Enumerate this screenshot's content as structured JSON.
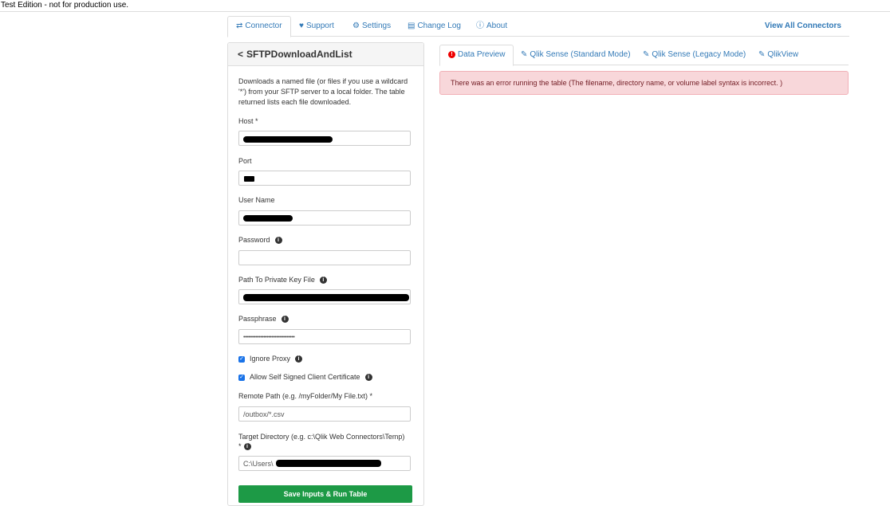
{
  "banner": "Test Edition - not for production use.",
  "topnav": {
    "tabs": [
      {
        "label": "Connector",
        "icon": "exchange-icon"
      },
      {
        "label": "Support",
        "icon": "heart-icon"
      },
      {
        "label": "Settings",
        "icon": "gear-icon"
      },
      {
        "label": "Change Log",
        "icon": "list-icon"
      },
      {
        "label": "About",
        "icon": "info-icon"
      }
    ],
    "view_all": "View All Connectors"
  },
  "panel": {
    "title": "SFTPDownloadAndList",
    "description": "Downloads a named file (or files if you use a wildcard '*') from your SFTP server to a local folder. The table returned lists each file downloaded.",
    "fields": {
      "host": {
        "label": "Host *",
        "value": ""
      },
      "port": {
        "label": "Port",
        "value": ""
      },
      "username": {
        "label": "User Name",
        "value": ""
      },
      "password": {
        "label": "Password",
        "value": ""
      },
      "private_key": {
        "label": "Path To Private Key File",
        "value": ""
      },
      "passphrase": {
        "label": "Passphrase",
        "value": "•••••••••••••••••••••••••••••••••"
      },
      "remote_path": {
        "label": "Remote Path (e.g. /myFolder/My File.txt) *",
        "value": "/outbox/*.csv"
      },
      "target_dir": {
        "label": "Target Directory (e.g. c:\\Qlik Web Connectors\\Temp)",
        "label2": "*",
        "value": "C:\\Users\\"
      }
    },
    "checkboxes": {
      "ignore_proxy": {
        "label": "Ignore Proxy",
        "checked": true
      },
      "self_signed": {
        "label": "Allow Self Signed Client Certificate",
        "checked": true
      }
    },
    "run_button": "Save Inputs & Run Table"
  },
  "right_tabs": [
    {
      "label": "Data Preview",
      "icon": "error-icon"
    },
    {
      "label": "Qlik Sense (Standard Mode)",
      "icon": "pencil-icon"
    },
    {
      "label": "Qlik Sense (Legacy Mode)",
      "icon": "pencil-icon"
    },
    {
      "label": "QlikView",
      "icon": "pencil-icon"
    }
  ],
  "error_message": "There was an error running the table (The filename, directory name, or volume label syntax is incorrect. )",
  "colors": {
    "link": "#337ab7",
    "run_button": "#1d9a46",
    "alert_bg": "#f8d7da",
    "alert_text": "#721c24"
  }
}
